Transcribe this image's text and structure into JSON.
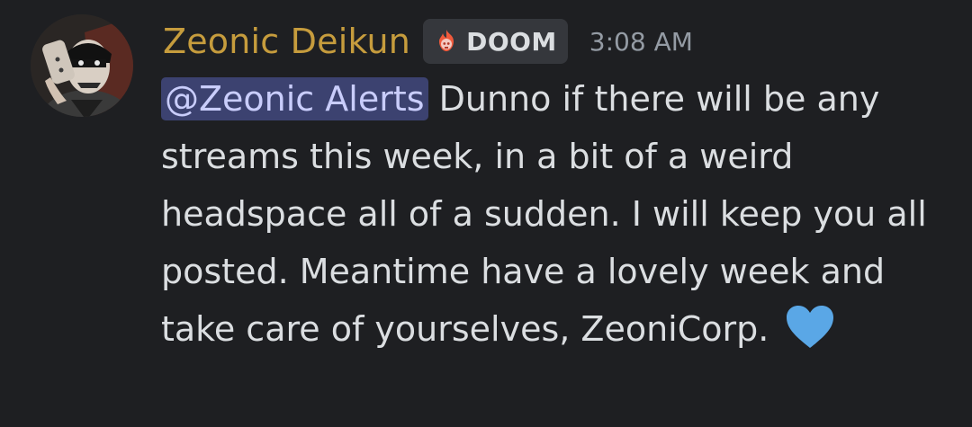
{
  "message": {
    "username": "Zeonic Deikun",
    "tag": {
      "label": "DOOM",
      "icon": "fire-skull-icon"
    },
    "timestamp": "3:08 AM",
    "mention": "@Zeonic Alerts",
    "text": " Dunno if there will be any streams this week, in a bit of a weird headspace all of a sudden. I will keep you all posted. Meantime have a lovely week and take care of yourselves, ZeoniCorp. ",
    "emoji": "blue-heart-icon"
  },
  "colors": {
    "background": "#1e1f22",
    "username": "#c69c3d",
    "text": "#dbdee1",
    "timestamp": "#949ba4",
    "mention_bg": "#3c4270",
    "mention_text": "#c9cdfb",
    "heart": "#5aa7e6"
  }
}
